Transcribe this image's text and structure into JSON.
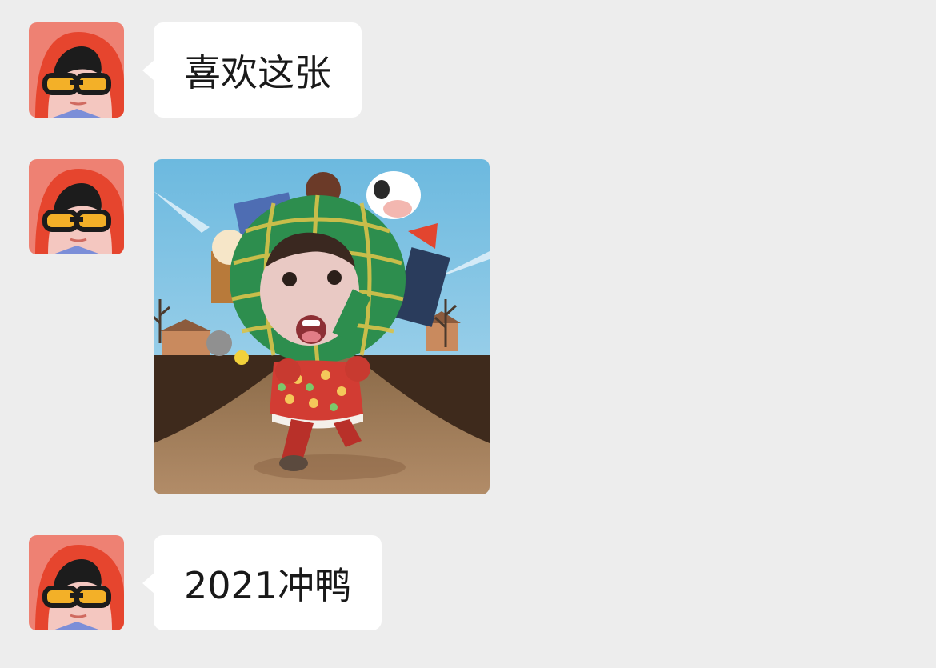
{
  "messages": [
    {
      "type": "text",
      "sender": "avatar-red-hood",
      "text": "喜欢这张"
    },
    {
      "type": "image",
      "sender": "avatar-red-hood",
      "image": "new-year-running-girl-sticker"
    },
    {
      "type": "text",
      "sender": "avatar-red-hood",
      "text": "2021冲鸭"
    }
  ],
  "colors": {
    "background": "#ededed",
    "bubble": "#ffffff",
    "text": "#191919",
    "avatar_bg": "#ee8173",
    "hood": "#e6452e",
    "glasses": "#f3b028"
  }
}
